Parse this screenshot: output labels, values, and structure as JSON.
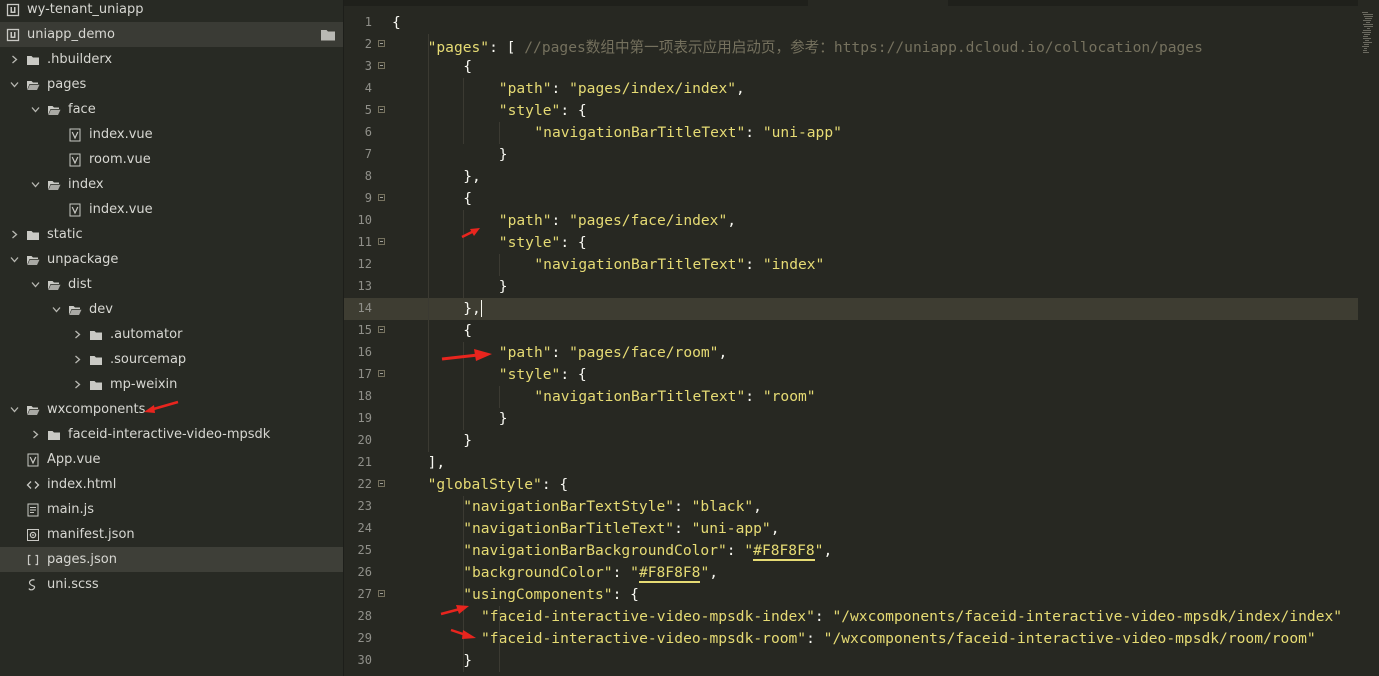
{
  "sidebar": {
    "items": [
      {
        "label": "wy-tenant_uniapp",
        "depth": 0,
        "chevron": "none",
        "icon": "project-icon",
        "style": "normal"
      },
      {
        "label": "uniapp_demo",
        "depth": 0,
        "chevron": "none",
        "icon": "project-icon",
        "style": "active-root"
      },
      {
        "label": ".hbuilderx",
        "depth": 0,
        "chevron": "right",
        "icon": "folder-icon",
        "style": "normal"
      },
      {
        "label": "pages",
        "depth": 0,
        "chevron": "down",
        "icon": "folder-open-icon",
        "style": "normal"
      },
      {
        "label": "face",
        "depth": 1,
        "chevron": "down",
        "icon": "folder-open-icon",
        "style": "normal"
      },
      {
        "label": "index.vue",
        "depth": 2,
        "chevron": "none",
        "icon": "vue-file-icon",
        "style": "normal"
      },
      {
        "label": "room.vue",
        "depth": 2,
        "chevron": "none",
        "icon": "vue-file-icon",
        "style": "normal"
      },
      {
        "label": "index",
        "depth": 1,
        "chevron": "down",
        "icon": "folder-open-icon",
        "style": "normal"
      },
      {
        "label": "index.vue",
        "depth": 2,
        "chevron": "none",
        "icon": "vue-file-icon",
        "style": "normal"
      },
      {
        "label": "static",
        "depth": 0,
        "chevron": "right",
        "icon": "folder-icon",
        "style": "normal"
      },
      {
        "label": "unpackage",
        "depth": 0,
        "chevron": "down",
        "icon": "folder-open-icon",
        "style": "normal"
      },
      {
        "label": "dist",
        "depth": 1,
        "chevron": "down",
        "icon": "folder-open-icon",
        "style": "normal"
      },
      {
        "label": "dev",
        "depth": 2,
        "chevron": "down",
        "icon": "folder-open-icon",
        "style": "normal"
      },
      {
        "label": ".automator",
        "depth": 3,
        "chevron": "right",
        "icon": "folder-icon",
        "style": "normal"
      },
      {
        "label": ".sourcemap",
        "depth": 3,
        "chevron": "right",
        "icon": "folder-icon",
        "style": "normal"
      },
      {
        "label": "mp-weixin",
        "depth": 3,
        "chevron": "right",
        "icon": "folder-icon",
        "style": "normal"
      },
      {
        "label": "wxcomponents",
        "depth": 0,
        "chevron": "down",
        "icon": "folder-open-icon",
        "style": "normal"
      },
      {
        "label": "faceid-interactive-video-mpsdk",
        "depth": 1,
        "chevron": "right",
        "icon": "folder-icon",
        "style": "normal"
      },
      {
        "label": "App.vue",
        "depth": 0,
        "chevron": "none",
        "icon": "vue-file-icon",
        "style": "normal"
      },
      {
        "label": "index.html",
        "depth": 0,
        "chevron": "none",
        "icon": "html-file-icon",
        "style": "normal"
      },
      {
        "label": "main.js",
        "depth": 0,
        "chevron": "none",
        "icon": "js-file-icon",
        "style": "normal"
      },
      {
        "label": "manifest.json",
        "depth": 0,
        "chevron": "none",
        "icon": "settings-file-icon",
        "style": "normal"
      },
      {
        "label": "pages.json",
        "depth": 0,
        "chevron": "none",
        "icon": "json-file-icon",
        "style": "selected"
      },
      {
        "label": "uni.scss",
        "depth": 0,
        "chevron": "none",
        "icon": "scss-file-icon",
        "style": "normal"
      }
    ]
  },
  "editor": {
    "current_line": 14,
    "lines": [
      {
        "n": "1",
        "fold": false,
        "indent": 0,
        "tokens": [
          [
            "p",
            "{"
          ]
        ]
      },
      {
        "n": "2",
        "fold": true,
        "indent": 1,
        "tokens": [
          [
            "k",
            "\"pages\""
          ],
          [
            "p",
            ": [ "
          ],
          [
            "c",
            "//pages数组中第一项表示应用启动页，参考：https://uniapp.dcloud.io/collocation/pages"
          ]
        ]
      },
      {
        "n": "3",
        "fold": true,
        "indent": 2,
        "tokens": [
          [
            "p",
            "{"
          ]
        ]
      },
      {
        "n": "4",
        "fold": false,
        "indent": 3,
        "tokens": [
          [
            "k",
            "\"path\""
          ],
          [
            "p",
            ": "
          ],
          [
            "k",
            "\"pages/index/index\""
          ],
          [
            "p",
            ","
          ]
        ]
      },
      {
        "n": "5",
        "fold": true,
        "indent": 3,
        "tokens": [
          [
            "k",
            "\"style\""
          ],
          [
            "p",
            ": {"
          ]
        ]
      },
      {
        "n": "6",
        "fold": false,
        "indent": 4,
        "tokens": [
          [
            "k",
            "\"navigationBarTitleText\""
          ],
          [
            "p",
            ": "
          ],
          [
            "k",
            "\"uni-app\""
          ]
        ]
      },
      {
        "n": "7",
        "fold": false,
        "indent": 3,
        "tokens": [
          [
            "p",
            "}"
          ]
        ]
      },
      {
        "n": "8",
        "fold": false,
        "indent": 2,
        "tokens": [
          [
            "p",
            "},"
          ]
        ]
      },
      {
        "n": "9",
        "fold": true,
        "indent": 2,
        "tokens": [
          [
            "p",
            "{"
          ]
        ]
      },
      {
        "n": "10",
        "fold": false,
        "indent": 3,
        "tokens": [
          [
            "k",
            "\"path\""
          ],
          [
            "p",
            ": "
          ],
          [
            "k",
            "\"pages/face/index\""
          ],
          [
            "p",
            ","
          ]
        ]
      },
      {
        "n": "11",
        "fold": true,
        "indent": 3,
        "tokens": [
          [
            "k",
            "\"style\""
          ],
          [
            "p",
            ": {"
          ]
        ]
      },
      {
        "n": "12",
        "fold": false,
        "indent": 4,
        "tokens": [
          [
            "k",
            "\"navigationBarTitleText\""
          ],
          [
            "p",
            ": "
          ],
          [
            "k",
            "\"index\""
          ]
        ]
      },
      {
        "n": "13",
        "fold": false,
        "indent": 3,
        "tokens": [
          [
            "p",
            "}"
          ]
        ]
      },
      {
        "n": "14",
        "fold": false,
        "indent": 2,
        "tokens": [
          [
            "p",
            "},"
          ]
        ]
      },
      {
        "n": "15",
        "fold": true,
        "indent": 2,
        "tokens": [
          [
            "p",
            "{"
          ]
        ]
      },
      {
        "n": "16",
        "fold": false,
        "indent": 3,
        "tokens": [
          [
            "k",
            "\"path\""
          ],
          [
            "p",
            ": "
          ],
          [
            "k",
            "\"pages/face/room\""
          ],
          [
            "p",
            ","
          ]
        ]
      },
      {
        "n": "17",
        "fold": true,
        "indent": 3,
        "tokens": [
          [
            "k",
            "\"style\""
          ],
          [
            "p",
            ": {"
          ]
        ]
      },
      {
        "n": "18",
        "fold": false,
        "indent": 4,
        "tokens": [
          [
            "k",
            "\"navigationBarTitleText\""
          ],
          [
            "p",
            ": "
          ],
          [
            "k",
            "\"room\""
          ]
        ]
      },
      {
        "n": "19",
        "fold": false,
        "indent": 3,
        "tokens": [
          [
            "p",
            "}"
          ]
        ]
      },
      {
        "n": "20",
        "fold": false,
        "indent": 2,
        "tokens": [
          [
            "p",
            "}"
          ]
        ]
      },
      {
        "n": "21",
        "fold": false,
        "indent": 1,
        "tokens": [
          [
            "p",
            "],"
          ]
        ]
      },
      {
        "n": "22",
        "fold": true,
        "indent": 1,
        "tokens": [
          [
            "k",
            "\"globalStyle\""
          ],
          [
            "p",
            ": {"
          ]
        ]
      },
      {
        "n": "23",
        "fold": false,
        "indent": 2,
        "tokens": [
          [
            "k",
            "\"navigationBarTextStyle\""
          ],
          [
            "p",
            ": "
          ],
          [
            "k",
            "\"black\""
          ],
          [
            "p",
            ","
          ]
        ]
      },
      {
        "n": "24",
        "fold": false,
        "indent": 2,
        "tokens": [
          [
            "k",
            "\"navigationBarTitleText\""
          ],
          [
            "p",
            ": "
          ],
          [
            "k",
            "\"uni-app\""
          ],
          [
            "p",
            ","
          ]
        ]
      },
      {
        "n": "25",
        "fold": false,
        "indent": 2,
        "tokens": [
          [
            "k",
            "\"navigationBarBackgroundColor\""
          ],
          [
            "p",
            ": "
          ],
          [
            "k",
            "\""
          ],
          [
            "u",
            "#F8F8F8"
          ],
          [
            "k",
            "\""
          ],
          [
            "p",
            ","
          ]
        ]
      },
      {
        "n": "26",
        "fold": false,
        "indent": 2,
        "tokens": [
          [
            "k",
            "\"backgroundColor\""
          ],
          [
            "p",
            ": "
          ],
          [
            "k",
            "\""
          ],
          [
            "u",
            "#F8F8F8"
          ],
          [
            "k",
            "\""
          ],
          [
            "p",
            ","
          ]
        ]
      },
      {
        "n": "27",
        "fold": true,
        "indent": 2,
        "tokens": [
          [
            "k",
            "\"usingComponents\""
          ],
          [
            "p",
            ": {"
          ]
        ]
      },
      {
        "n": "28",
        "fold": false,
        "indent": 2.5,
        "tokens": [
          [
            "k",
            "\"faceid-interactive-video-mpsdk-index\""
          ],
          [
            "p",
            ": "
          ],
          [
            "k",
            "\"/wxcomponents/faceid-interactive-video-mpsdk/index/index\""
          ]
        ]
      },
      {
        "n": "29",
        "fold": false,
        "indent": 2.5,
        "tokens": [
          [
            "k",
            "\"faceid-interactive-video-mpsdk-room\""
          ],
          [
            "p",
            ": "
          ],
          [
            "k",
            "\"/wxcomponents/faceid-interactive-video-mpsdk/room/room\""
          ]
        ]
      },
      {
        "n": "30",
        "fold": false,
        "indent": 2,
        "tokens": [
          [
            "p",
            "}"
          ]
        ]
      }
    ]
  },
  "colors": {
    "annotation_arrow": "#e8251e",
    "string": "#e6db74",
    "comment": "#75715e",
    "background": "#272822"
  }
}
